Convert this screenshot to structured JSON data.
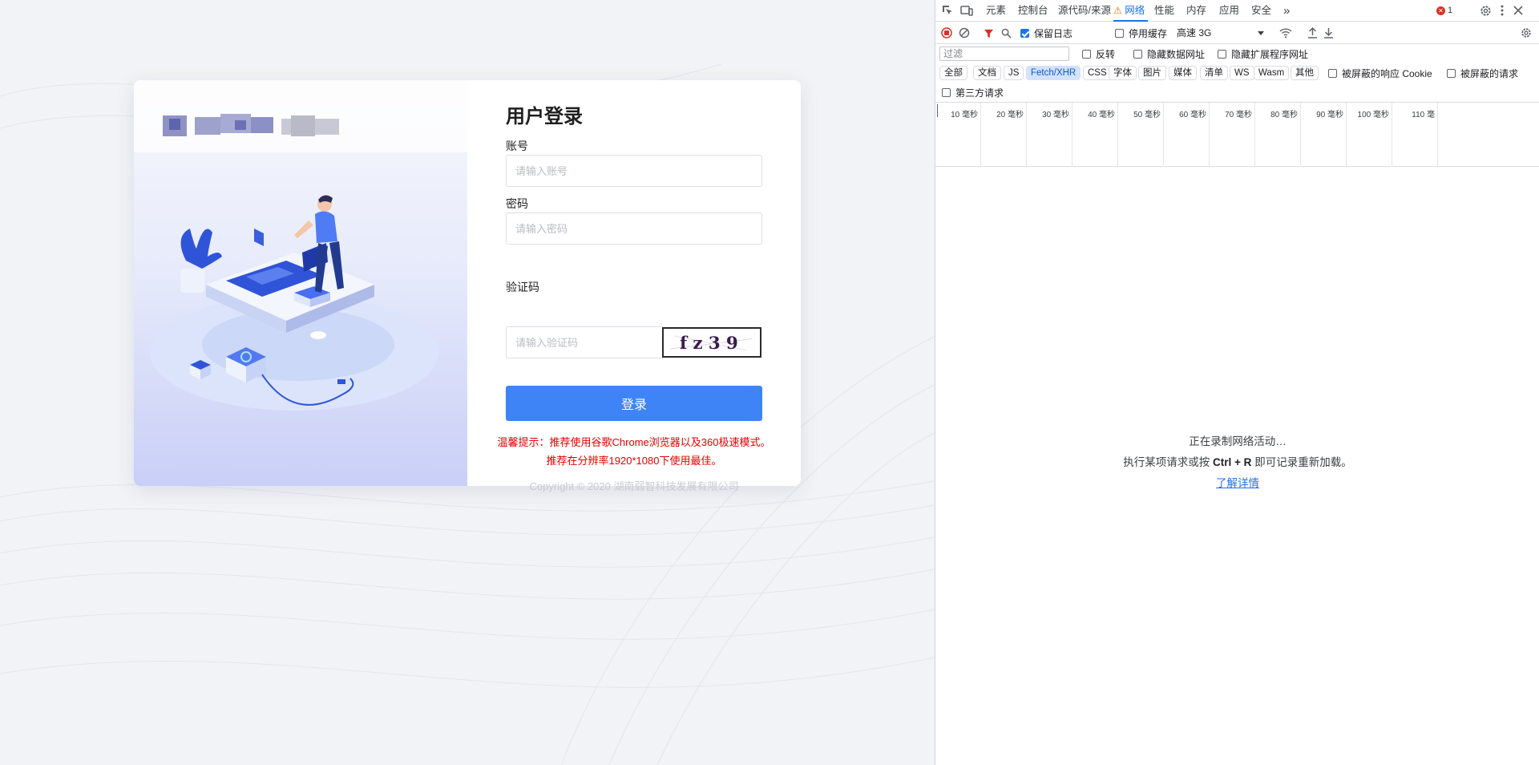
{
  "login": {
    "title": "用户登录",
    "account_label": "账号",
    "account_placeholder": "请输入账号",
    "password_label": "密码",
    "password_placeholder": "请输入密码",
    "captcha_label": "验证码",
    "captcha_placeholder": "请输入验证码",
    "captcha_text": "fz39",
    "login_button": "登录",
    "tip_line1": "温馨提示：推荐使用谷歌Chrome浏览器以及360极速模式。",
    "tip_line2": "推荐在分辨率1920*1080下使用最佳。",
    "copyright": "Copyright © 2020 湖南弱智科技发展有限公司"
  },
  "devtools": {
    "tabs": [
      "元素",
      "控制台",
      "源代码/来源",
      "网络",
      "性能",
      "内存",
      "应用",
      "安全"
    ],
    "active_tab": "网络",
    "more_tabs": "»",
    "error_count": "1",
    "toolbar": {
      "preserve_log": "保留日志",
      "preserve_log_checked": true,
      "disable_cache": "停用缓存",
      "disable_cache_checked": false,
      "throttle": "高速 3G"
    },
    "filter": {
      "placeholder": "过滤",
      "invert": "反转",
      "hide_data_urls": "隐藏数据网址",
      "hide_extension_urls": "隐藏扩展程序网址"
    },
    "types": [
      "全部",
      "文档",
      "JS",
      "Fetch/XHR",
      "CSS",
      "字体",
      "图片",
      "媒体",
      "清单",
      "WS",
      "Wasm",
      "其他"
    ],
    "active_type": "Fetch/XHR",
    "blocked_cookies": "被屏蔽的响应 Cookie",
    "blocked_requests": "被屏蔽的请求",
    "third_party": "第三方请求",
    "timeline_ticks": [
      "10 毫秒",
      "20 毫秒",
      "30 毫秒",
      "40 毫秒",
      "50 毫秒",
      "60 毫秒",
      "70 毫秒",
      "80 毫秒",
      "90 毫秒",
      "100 毫秒",
      "110 毫"
    ],
    "empty": {
      "recording": "正在录制网络活动…",
      "hint_before": "执行某项请求或按 ",
      "hint_key": "Ctrl + R",
      "hint_after": " 即可记录重新加载。",
      "learn_more": "了解详情"
    }
  },
  "colors": {
    "primary": "#3e84f6",
    "tip": "#e60000",
    "devtools_accent": "#1a73e8"
  }
}
